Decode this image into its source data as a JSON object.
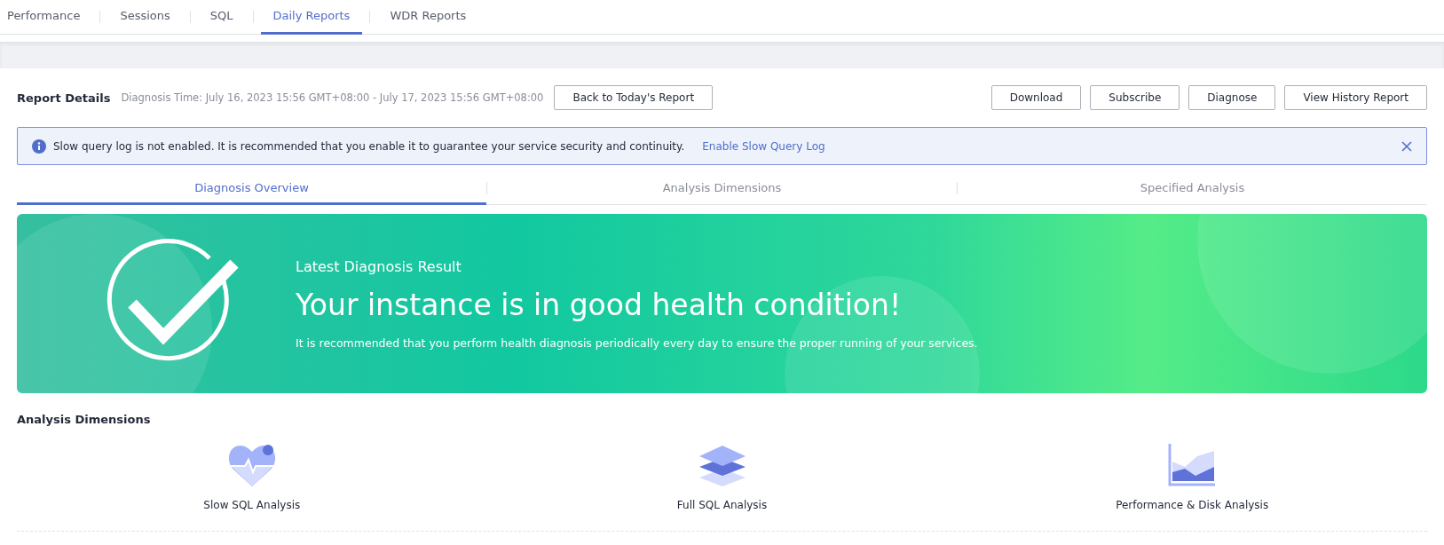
{
  "nav_tabs": [
    {
      "label": "Performance",
      "selected": false
    },
    {
      "label": "Sessions",
      "selected": false
    },
    {
      "label": "SQL",
      "selected": false
    },
    {
      "label": "Daily Reports",
      "selected": true
    },
    {
      "label": "WDR Reports",
      "selected": false
    }
  ],
  "report": {
    "title": "Report Details",
    "time": "Diagnosis Time: July 16, 2023 15:56 GMT+08:00 - July 17, 2023 15:56 GMT+08:00",
    "back_button": "Back to Today's Report",
    "actions": [
      "Download",
      "Subscribe",
      "Diagnose",
      "View History Report"
    ]
  },
  "alert": {
    "message": "Slow query log is not enabled. It is recommended that you enable it to guarantee your service security and continuity.",
    "link": "Enable Slow Query Log"
  },
  "sub_tabs": [
    {
      "label": "Diagnosis Overview",
      "selected": true
    },
    {
      "label": "Analysis Dimensions",
      "selected": false
    },
    {
      "label": "Specified Analysis",
      "selected": false
    }
  ],
  "banner": {
    "kicker": "Latest Diagnosis Result",
    "headline": "Your instance is in good health condition!",
    "note": "It is recommended that you perform health diagnosis periodically every day to ensure the proper running of your services."
  },
  "dimensions": {
    "title": "Analysis Dimensions",
    "items": [
      {
        "kind": "heart",
        "label": "Slow SQL Analysis"
      },
      {
        "kind": "layers",
        "label": "Full SQL Analysis"
      },
      {
        "kind": "chart",
        "label": "Performance & Disk Analysis"
      }
    ]
  }
}
